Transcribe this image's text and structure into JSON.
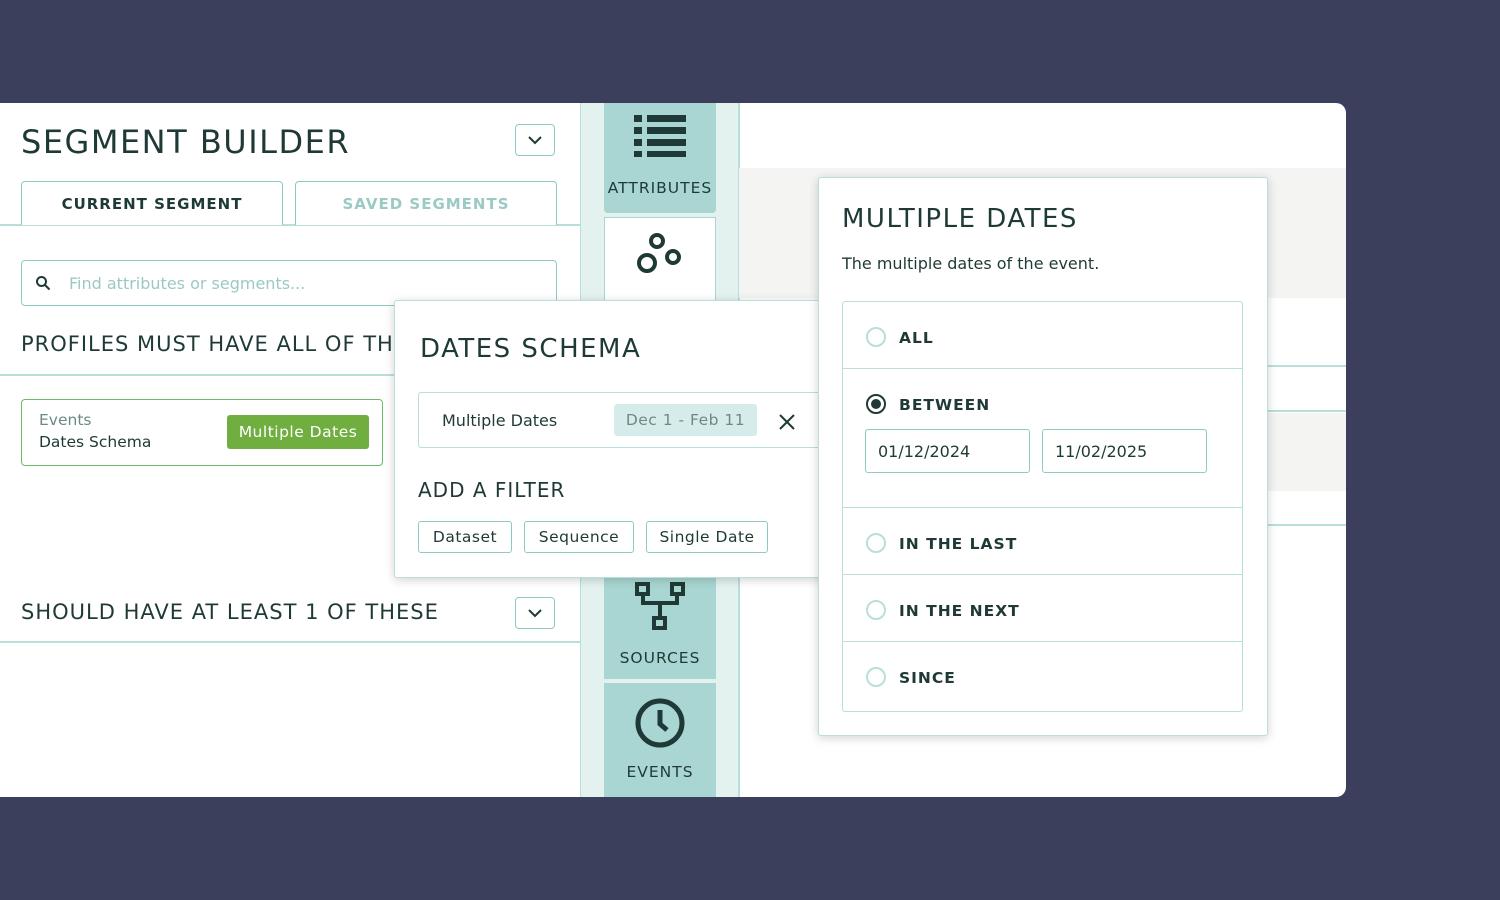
{
  "colors": {
    "background": "#3c3f5c",
    "accent_teal": "#8fc9c4",
    "rail_tile": "#a9d6d2",
    "chip_green": "#6fae3f",
    "text_dark": "#1f3a36"
  },
  "builder": {
    "title": "SEGMENT BUILDER",
    "tabs": [
      {
        "label": "CURRENT SEGMENT",
        "active": true
      },
      {
        "label": "SAVED SEGMENTS",
        "active": false
      }
    ],
    "search": {
      "placeholder": "Find attributes or segments..."
    },
    "must_have_heading": "PROFILES MUST HAVE ALL OF THESE",
    "rule": {
      "category": "Events",
      "name": "Dates Schema",
      "chip": "Multiple Dates"
    },
    "should_have_heading": "SHOULD HAVE AT LEAST 1 OF THESE"
  },
  "rail": {
    "items": [
      {
        "label": "ATTRIBUTES",
        "icon": "list-icon"
      },
      {
        "label": "",
        "icon": "segments-icon"
      },
      {
        "label": "SOURCES",
        "icon": "hierarchy-icon"
      },
      {
        "label": "EVENTS",
        "icon": "clock-icon"
      }
    ]
  },
  "dates_schema": {
    "title": "DATES SCHEMA",
    "field_label": "Multiple Dates",
    "range_chip": "Dec 1 - Feb 11",
    "add_filter_heading": "ADD A FILTER",
    "filters": [
      "Dataset",
      "Sequence",
      "Single Date"
    ]
  },
  "multiple_dates": {
    "title": "MULTIPLE DATES",
    "description": "The multiple dates of the event.",
    "options": [
      {
        "label": "ALL",
        "selected": false
      },
      {
        "label": "BETWEEN",
        "selected": true
      },
      {
        "label": "IN THE LAST",
        "selected": false
      },
      {
        "label": "IN THE NEXT",
        "selected": false
      },
      {
        "label": "SINCE",
        "selected": false
      }
    ],
    "between_start": "01/12/2024",
    "between_end": "11/02/2025"
  }
}
